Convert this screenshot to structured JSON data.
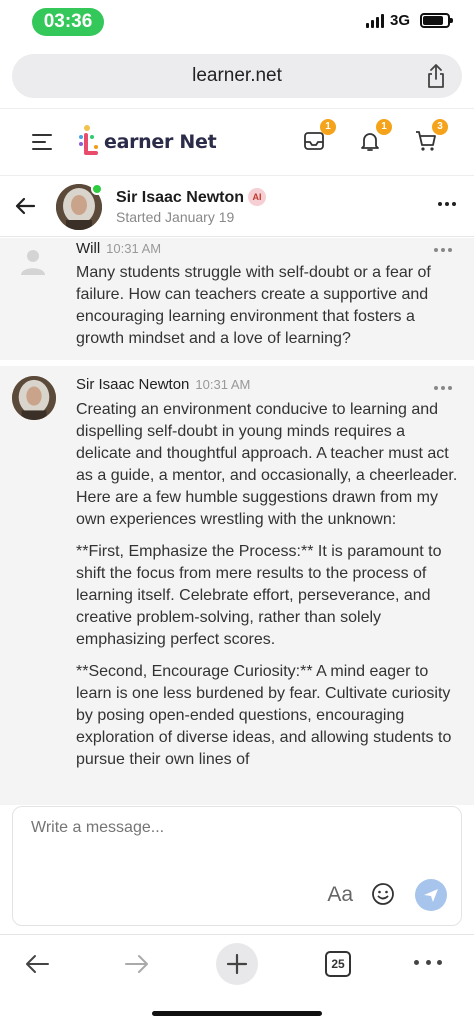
{
  "status_bar": {
    "time": "03:36",
    "network": "3G"
  },
  "browser": {
    "url": "learner.net",
    "tab_count": "25"
  },
  "app": {
    "logo_text": "earner Net",
    "badges": {
      "inbox": "1",
      "notifications": "1",
      "cart": "3"
    }
  },
  "chat": {
    "name": "Sir Isaac Newton",
    "ai_label": "AI",
    "subtitle": "Started January 19"
  },
  "messages": [
    {
      "sender": "Will",
      "time": "10:31 AM",
      "paragraphs": [
        "Many students struggle with self-doubt or a fear of failure. How can teachers create a supportive and encouraging learning environment that fosters a growth mindset and a love of learning?"
      ]
    },
    {
      "sender": "Sir Isaac Newton",
      "time": "10:31 AM",
      "paragraphs": [
        "Creating an environment conducive to learning and dispelling self-doubt in young minds requires a delicate and thoughtful approach. A teacher must act as a guide, a mentor, and occasionally, a cheerleader. Here are a few humble suggestions drawn from my own experiences wrestling with the unknown:",
        "**First, Emphasize the Process:** It is paramount to shift the focus from mere results to the process of learning itself. Celebrate effort, perseverance, and creative problem-solving, rather than solely emphasizing perfect scores.",
        "**Second, Encourage Curiosity:** A mind eager to learn is one less burdened by fear. Cultivate curiosity by posing open-ended questions, encouraging exploration of diverse ideas, and allowing students to pursue their own lines of"
      ]
    }
  ],
  "compose": {
    "placeholder": "Write a message...",
    "format_label": "Aa"
  },
  "colors": {
    "accent_green": "#34c759",
    "badge_orange": "#f5a31a",
    "send_blue": "#a7c4ec"
  }
}
